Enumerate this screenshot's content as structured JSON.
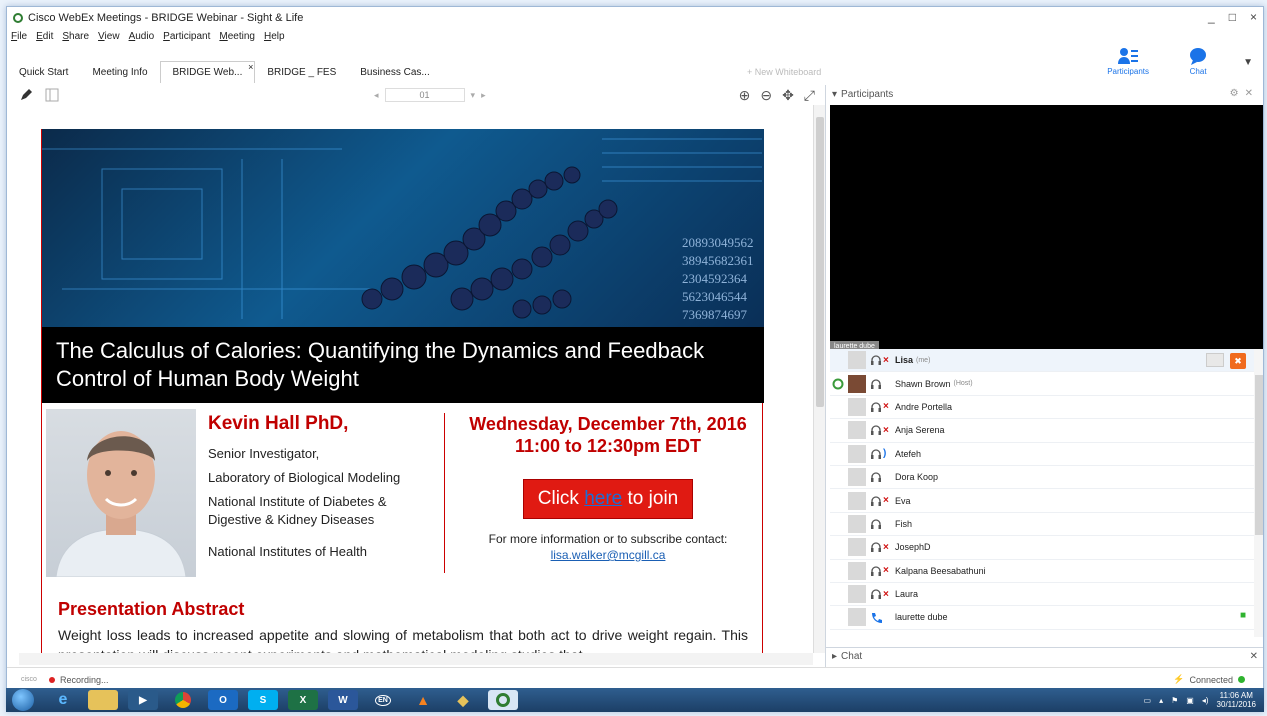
{
  "window": {
    "title": "Cisco WebEx Meetings - BRIDGE Webinar - Sight & Life",
    "controls": [
      "_",
      "□",
      "×"
    ]
  },
  "menu": [
    "File",
    "Edit",
    "Share",
    "View",
    "Audio",
    "Participant",
    "Meeting",
    "Help"
  ],
  "tabs": [
    {
      "label": "Quick Start",
      "active": false
    },
    {
      "label": "Meeting Info",
      "active": false
    },
    {
      "label": "BRIDGE Web...",
      "active": true,
      "close": "×"
    },
    {
      "label": "BRIDGE _ FES",
      "active": false
    },
    {
      "label": "Business Cas...",
      "active": false
    }
  ],
  "new_whiteboard": "+ New Whiteboard",
  "right_tools": {
    "participants": "Participants",
    "chat": "Chat"
  },
  "pager": {
    "page": "01"
  },
  "slide": {
    "hero_title": "The Calculus of Calories: Quantifying the Dynamics and Feedback Control of Human Body Weight",
    "hero_numbers": [
      "20893049562",
      "38945682361",
      "2304592364",
      "5623046544",
      "7369874697"
    ],
    "speaker_name": "Kevin Hall PhD,",
    "speaker_role": "Senior Investigator,",
    "speaker_lab": "Laboratory of Biological Modeling",
    "speaker_inst": "National Institute of Diabetes & Digestive & Kidney Diseases",
    "speaker_org": "National Institutes of Health",
    "event_date": "Wednesday, December 7th, 2016",
    "event_time": "11:00 to 12:30pm EDT",
    "join": {
      "pre": "Click ",
      "link": "here",
      "post": " to join"
    },
    "more_info": "For more information or to subscribe contact: ",
    "email": "lisa.walker@mcgill.ca",
    "abstract_title": "Presentation Abstract",
    "abstract_text": "Weight loss leads to increased appetite and slowing of metabolism that both act to drive weight regain. This presentation will discuss recent experiments and mathematical modeling studies that"
  },
  "participants_panel": {
    "title": "Participants",
    "video_label": "laurette dube",
    "list": [
      {
        "name": "Lisa",
        "role": "(me)",
        "muted": true,
        "guest": true,
        "me": true
      },
      {
        "name": "Shawn Brown",
        "role": "(Host)",
        "muted": false,
        "guest": false,
        "host": true
      },
      {
        "name": "Andre Portella",
        "role": "",
        "muted": true,
        "guest": true
      },
      {
        "name": "Anja Serena",
        "role": "",
        "muted": true,
        "guest": true
      },
      {
        "name": "Atefeh",
        "role": "",
        "muted": false,
        "guest": true,
        "speaking": true
      },
      {
        "name": "Dora Koop",
        "role": "",
        "muted": false,
        "guest": false
      },
      {
        "name": "Eva",
        "role": "",
        "muted": true,
        "guest": true
      },
      {
        "name": "Fish",
        "role": "",
        "muted": false,
        "guest": true
      },
      {
        "name": "JosephD",
        "role": "",
        "muted": true,
        "guest": true
      },
      {
        "name": "Kalpana Beesabathuni",
        "role": "",
        "muted": true,
        "guest": true
      },
      {
        "name": "Laura",
        "role": "",
        "muted": true,
        "guest": true
      },
      {
        "name": "laurette dube",
        "role": "",
        "muted": false,
        "guest": true,
        "phone": true,
        "video": true
      }
    ]
  },
  "chat_panel": {
    "title": "Chat"
  },
  "status": {
    "logo": "cisco",
    "recording": "Recording...",
    "connected": "Connected"
  },
  "taskbar": {
    "time": "11:06 AM",
    "date": "30/11/2016",
    "lang": "EN"
  },
  "colors": {
    "accent_red": "#c00000",
    "join_red": "#e01a12",
    "blue": "#1a73e8",
    "connected_green": "#2fb32f"
  }
}
